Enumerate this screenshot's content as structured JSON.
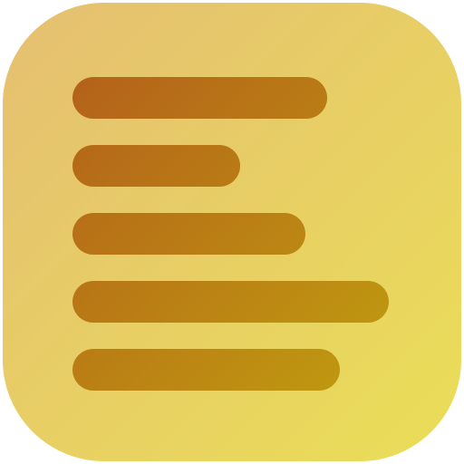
{
  "app_icon": {
    "name": "text-align-left-app-icon",
    "background_gradient": {
      "from": "#E5BF72",
      "to": "#EADE57"
    },
    "bar_gradient": {
      "from": "#B4621A",
      "to": "#C09C0F"
    },
    "bar_count": 5
  }
}
